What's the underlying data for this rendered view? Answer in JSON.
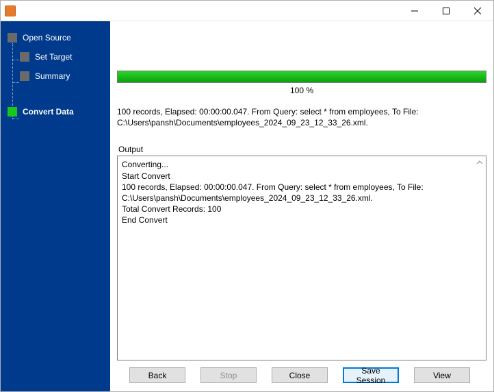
{
  "window": {
    "title": ""
  },
  "sidebar": {
    "items": [
      {
        "label": "Open Source"
      },
      {
        "label": "Set Target"
      },
      {
        "label": "Summary"
      },
      {
        "label": "Convert Data"
      }
    ]
  },
  "progress": {
    "percent_label": "100 %"
  },
  "summary_text": "100 records,    Elapsed: 00:00:00.047.    From Query: select * from employees,    To File: C:\\Users\\pansh\\Documents\\employees_2024_09_23_12_33_26.xml.",
  "output": {
    "label": "Output",
    "lines": [
      "Converting...",
      "Start Convert",
      "100 records,    Elapsed: 00:00:00.047.    From Query: select * from employees,    To File: C:\\Users\\pansh\\Documents\\employees_2024_09_23_12_33_26.xml.",
      "Total Convert Records: 100",
      "End Convert"
    ]
  },
  "buttons": {
    "back": "Back",
    "stop": "Stop",
    "close": "Close",
    "save_session": "Save Session",
    "view": "View"
  }
}
